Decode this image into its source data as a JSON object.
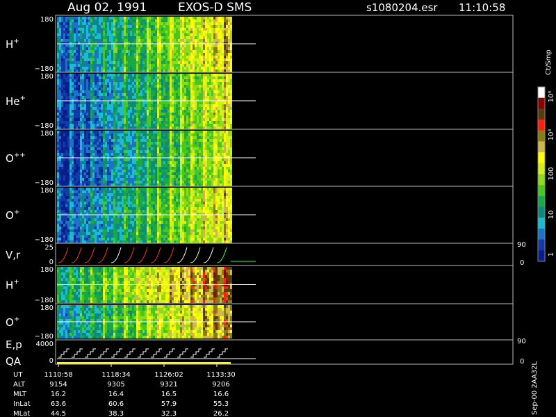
{
  "header": {
    "date": "Aug 02, 1991",
    "mission": "EXOS-D SMS",
    "file": "s1080204.esr",
    "time": "11:10:58"
  },
  "colorbar": {
    "units": "Ct/Smp",
    "labels": [
      "10⁴",
      "10³",
      "100",
      "10",
      "1"
    ]
  },
  "colors": {
    "bg": "#000000",
    "palette": [
      "#0a1d8c",
      "#123aa8",
      "#1c72c9",
      "#19bcd0",
      "#0d8a7a",
      "#18a84a",
      "#46c81f",
      "#8ddc1a",
      "#d8ee18",
      "#ffff00",
      "#cfb84a",
      "#8a7c10",
      "#5a3b0a",
      "#ff1f10",
      "#8b0000"
    ]
  },
  "panels": [
    {
      "label_main": "H",
      "label_sup": "+",
      "tick_top": "180",
      "tick_bot": "−180"
    },
    {
      "label_main": "He",
      "label_sup": "+",
      "tick_top": "180",
      "tick_bot": "−180"
    },
    {
      "label_main": "O",
      "label_sup": "++",
      "tick_top": "180",
      "tick_bot": "−180"
    },
    {
      "label_main": "O",
      "label_sup": "+",
      "tick_top": "180",
      "tick_bot": "−180"
    },
    {
      "label_main": "V,r",
      "label_sup": "",
      "tick_top": "25",
      "tick_bot": "0",
      "right_top": "90",
      "right_bot": "0"
    },
    {
      "label_main": "H",
      "label_sup": "+",
      "tick_top": "180",
      "tick_bot": "−180"
    },
    {
      "label_main": "O",
      "label_sup": "+",
      "tick_top": "180",
      "tick_bot": "−180"
    },
    {
      "label_main": "E,p",
      "label_sup": "",
      "label_main2": "QA",
      "tick_top": "4000",
      "tick_bot": "0",
      "right_top": "90",
      "right_bot": "0"
    }
  ],
  "footer": {
    "row_labels": [
      "UT",
      "ALT",
      "MLT",
      "InLat",
      "MLat"
    ],
    "columns": [
      [
        "1110:58",
        "9154",
        "16.2",
        "63.6",
        "44.5"
      ],
      [
        "1118:34",
        "9305",
        "16.4",
        "60.6",
        "38.3"
      ],
      [
        "1126:02",
        "9321",
        "16.5",
        "57.9",
        "32.3"
      ],
      [
        "1133:30",
        "9206",
        "16.6",
        "55.3",
        "26.2"
      ]
    ],
    "side_note": "Sep-00  2AA32L"
  },
  "chart_data": {
    "type": "heatmap",
    "title": "EXOS-D SMS",
    "xlabel": "UT",
    "x_ticks": [
      "1110:58",
      "1118:34",
      "1126:02",
      "1133:30"
    ],
    "panels": [
      "H+",
      "He+",
      "O++",
      "O+",
      "V,r",
      "H+",
      "O+",
      "E,p / QA"
    ],
    "ylim_pitch": [
      -180,
      180
    ],
    "ylim_vr": [
      0,
      25
    ],
    "ylim_ep": [
      0,
      4000
    ],
    "colorbar_unit": "Ct/Smp",
    "colorbar_range": [
      1,
      10000
    ],
    "colorbar_scale": "log"
  }
}
